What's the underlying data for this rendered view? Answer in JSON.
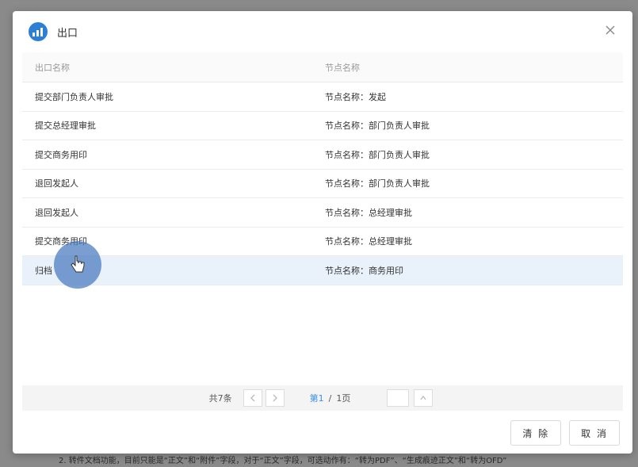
{
  "dialog": {
    "title": "出口",
    "logo_icon": "workflow-logo-icon",
    "close_icon": "close-icon"
  },
  "table": {
    "columns": [
      "出口名称",
      "节点名称"
    ],
    "rows": [
      {
        "exit": "提交部门负责人审批",
        "node": "节点名称：发起"
      },
      {
        "exit": "提交总经理审批",
        "node": "节点名称：部门负责人审批"
      },
      {
        "exit": "提交商务用印",
        "node": "节点名称：部门负责人审批"
      },
      {
        "exit": "退回发起人",
        "node": "节点名称：部门负责人审批"
      },
      {
        "exit": "退回发起人",
        "node": "节点名称：总经理审批"
      },
      {
        "exit": "提交商务用印",
        "node": "节点名称：总经理审批"
      },
      {
        "exit": "归档",
        "node": "节点名称：商务用印"
      }
    ],
    "selected_index": 6
  },
  "pagination": {
    "total": "共7条",
    "current": "第1",
    "separator": "/",
    "pages": "1页"
  },
  "buttons": {
    "clear": "清 除",
    "cancel": "取 消"
  },
  "background_text": "2. 转件文档功能，目前只能是“正文”和“附件”字段，对于“正文”字段，可选动作有：“转为PDF”、“生成痕迹正文”和“转为OFD”",
  "colors": {
    "accent": "#3a8ee6",
    "selected_row": "#e9f1fb",
    "logo": "#2d7fd6"
  }
}
